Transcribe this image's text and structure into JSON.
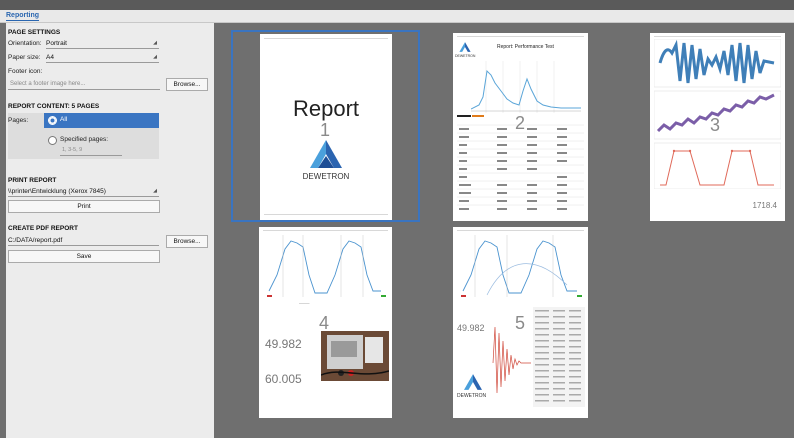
{
  "tab": {
    "label": "Reporting"
  },
  "page_settings": {
    "heading": "PAGE SETTINGS",
    "orientation_label": "Orientation:",
    "orientation_value": "Portrait",
    "paper_label": "Paper size:",
    "paper_value": "A4",
    "footer_label": "Footer icon:",
    "footer_placeholder": "Select a footer image here...",
    "browse_label": "Browse..."
  },
  "report_content": {
    "heading": "REPORT CONTENT: 5 PAGES",
    "pages_label": "Pages:",
    "all_label": "All",
    "specified_label": "Specified pages:",
    "specified_placeholder": "1, 3-5, 9"
  },
  "print_report": {
    "heading": "PRINT REPORT",
    "printer_value": "\\\\printer\\Entwicklung (Xerox 7845)",
    "print_label": "Print"
  },
  "pdf_report": {
    "heading": "CREATE PDF REPORT",
    "path_value": "C:/DATA/report.pdf",
    "browse_label": "Browse...",
    "save_label": "Save"
  },
  "pages": [
    {
      "number": "1",
      "title": "Report",
      "logo_text": "DEWETRON"
    },
    {
      "number": "2",
      "title": "Report: Performance Test",
      "logo_text": "DEWETRON"
    },
    {
      "number": "3",
      "value": "1718.4"
    },
    {
      "number": "4",
      "value1": "49.982",
      "value2": "60.005"
    },
    {
      "number": "5",
      "value1": "49.982",
      "logo_text": "DEWETRON"
    }
  ]
}
